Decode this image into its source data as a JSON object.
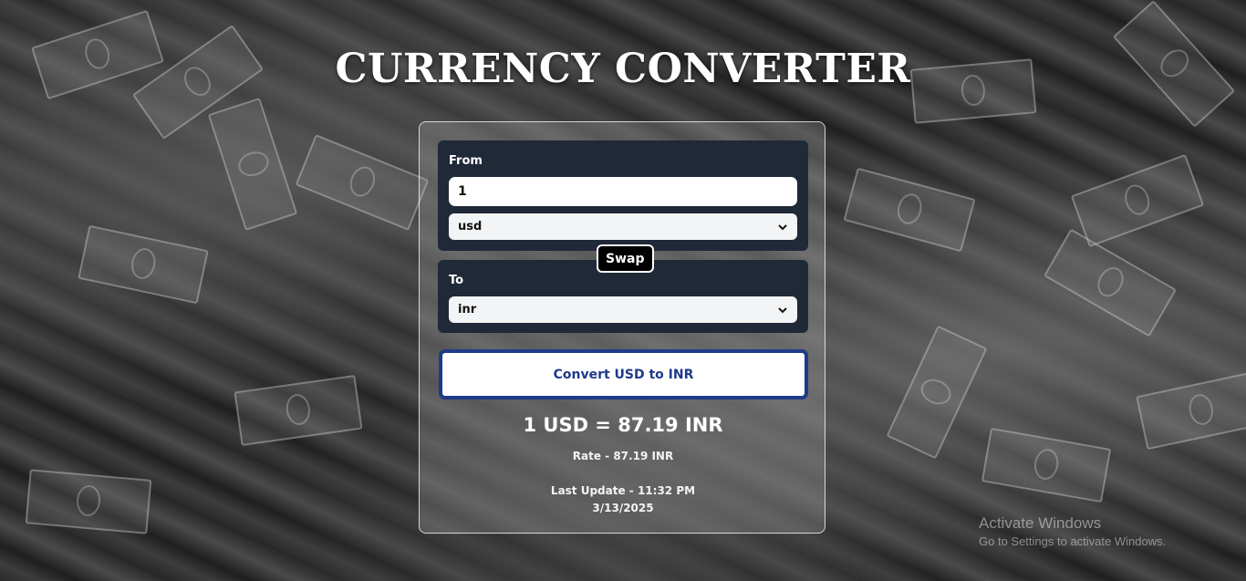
{
  "page": {
    "title": "CURRENCY CONVERTER"
  },
  "converter": {
    "from": {
      "label": "From",
      "amount": "1",
      "currency": "usd"
    },
    "swap_label": "Swap",
    "to": {
      "label": "To",
      "currency": "inr"
    },
    "convert_label": "Convert USD to INR",
    "result": "1 USD = 87.19 INR",
    "rate": "Rate - 87.19 INR",
    "last_update_line1": "Last Update - 11:32 PM",
    "last_update_line2": "3/13/2025"
  },
  "os_watermark": {
    "title": "Activate Windows",
    "subtitle": "Go to Settings to activate Windows."
  },
  "colors": {
    "panel_bg": "#1f2937",
    "convert_border": "#1e3a8a",
    "convert_text": "#1e3a8a",
    "swap_bg": "#000000"
  },
  "icons": {
    "select_arrow": "chevron-down-icon"
  }
}
